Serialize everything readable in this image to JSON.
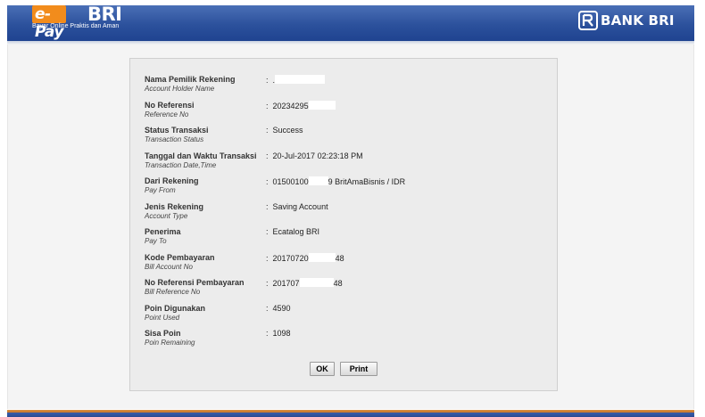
{
  "header": {
    "logo_epay": "e-Pay",
    "logo_bri": "BRI",
    "logo_tagline": "Bayar Online Praktis dan Aman",
    "bank_name": "BANK BRI",
    "colors": {
      "header_blue": "#2c519c",
      "logo_orange": "#f28c1c"
    }
  },
  "receipt": {
    "separator": ":",
    "rows": [
      {
        "label": "Nama Pemilik Rekening",
        "label_en": "Account Holder Name",
        "value": "."
      },
      {
        "label": "No Referensi",
        "label_en": "Reference No",
        "value": "20234295"
      },
      {
        "label": "Status Transaksi",
        "label_en": "Transaction Status",
        "value": "Success"
      },
      {
        "label": "Tanggal dan Waktu Transaksi",
        "label_en": "Transaction Date,Time",
        "value": "20-Jul-2017 02:23:18 PM"
      },
      {
        "label": "Dari Rekening",
        "label_en": "Pay From",
        "value_a": "01500100",
        "value_b": "9 BritAmaBisnis / IDR"
      },
      {
        "label": "Jenis Rekening",
        "label_en": "Account Type",
        "value": "Saving Account"
      },
      {
        "label": "Penerima",
        "label_en": "Pay To",
        "value": "Ecatalog BRI"
      },
      {
        "label": "Kode Pembayaran",
        "label_en": "Bill Account No",
        "value_a": "20170720",
        "value_b": "48"
      },
      {
        "label": "No Referensi Pembayaran",
        "label_en": "Bill Reference No",
        "value_a": "201707",
        "value_b": "48"
      },
      {
        "label": "Poin Digunakan",
        "label_en": "Point Used",
        "value": "4590"
      },
      {
        "label": "Sisa Poin",
        "label_en": "Poin Remaining",
        "value": "1098"
      }
    ]
  },
  "actions": {
    "ok_label": "OK",
    "print_label": "Print"
  }
}
